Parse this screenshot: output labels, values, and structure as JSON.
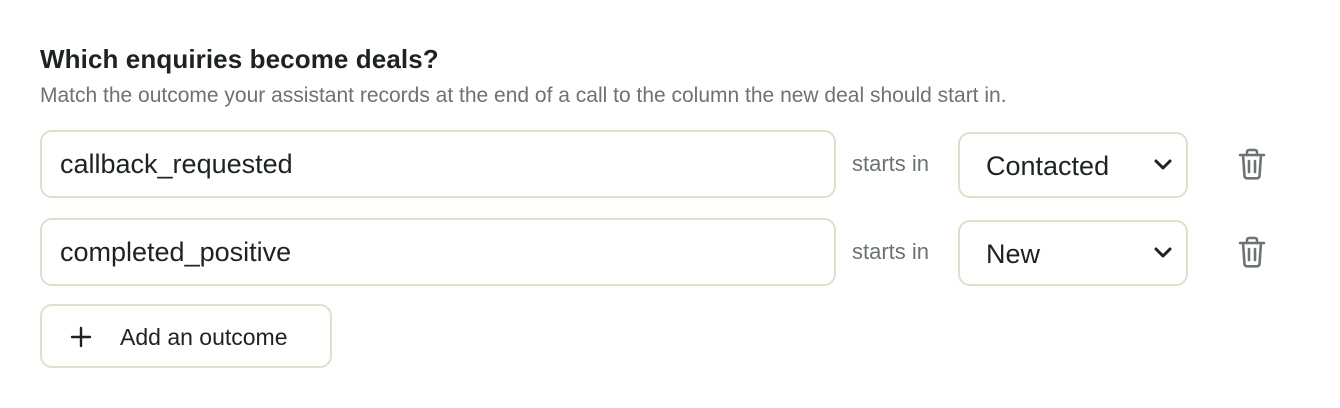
{
  "section": {
    "title": "Which enquiries become deals?",
    "description": "Match the outcome your assistant records at the end of a call to the column the new deal should start in."
  },
  "mappings": [
    {
      "outcome": "callback_requested",
      "connector": "starts in",
      "stage": "Contacted"
    },
    {
      "outcome": "completed_positive",
      "connector": "starts in",
      "stage": "New"
    }
  ],
  "add_button": {
    "label": "Add an outcome",
    "icon": "plus-icon"
  },
  "icons": {
    "delete": "trash-icon",
    "dropdown": "chevron-down-icon"
  },
  "colors": {
    "text": "#1c2321",
    "muted_text": "#6b7472",
    "border": "#e4ddcd",
    "icon": "#6b7472"
  }
}
